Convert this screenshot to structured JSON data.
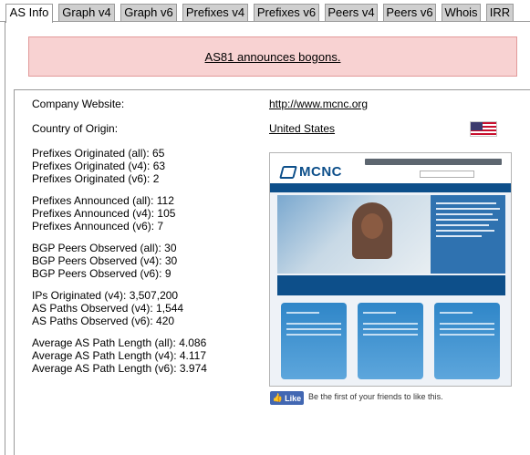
{
  "tabs": [
    {
      "label": "AS Info",
      "active": true
    },
    {
      "label": "Graph v4"
    },
    {
      "label": "Graph v6"
    },
    {
      "label": "Prefixes v4"
    },
    {
      "label": "Prefixes v6"
    },
    {
      "label": "Peers v4"
    },
    {
      "label": "Peers v6"
    },
    {
      "label": "Whois"
    },
    {
      "label": "IRR"
    }
  ],
  "alert": {
    "text": "AS81 announces bogons."
  },
  "info": {
    "company_website_label": "Company Website:",
    "company_website_value": "http://www.mcnc.org",
    "country_label": "Country of Origin:",
    "country_value": "United States",
    "stats": [
      "Prefixes Originated (all): 65",
      "Prefixes Originated (v4): 63",
      "Prefixes Originated (v6): 2",
      "Prefixes Announced (all): 112",
      "Prefixes Announced (v4): 105",
      "Prefixes Announced (v6): 7",
      "BGP Peers Observed (all): 30",
      "BGP Peers Observed (v4): 30",
      "BGP Peers Observed (v6): 9",
      "IPs Originated (v4): 3,507,200",
      "AS Paths Observed (v4): 1,544",
      "AS Paths Observed (v6): 420",
      "Average AS Path Length (all): 4.086",
      "Average AS Path Length (v4): 4.117",
      "Average AS Path Length (v6): 3.974"
    ]
  },
  "thumbnail": {
    "logo_text": "MCNC"
  },
  "facebook": {
    "like_label": "Like",
    "social_text": "Be the first of your friends to like this."
  },
  "colors": {
    "alert_bg": "#f8d2d2",
    "alert_border": "#e29a9a",
    "tab_bg": "#cfcfcf",
    "facebook_blue": "#4267b2",
    "mcnc_blue": "#0d4f8a"
  },
  "icons": [
    "us-flag-icon",
    "facebook-like-thumb-icon"
  ]
}
